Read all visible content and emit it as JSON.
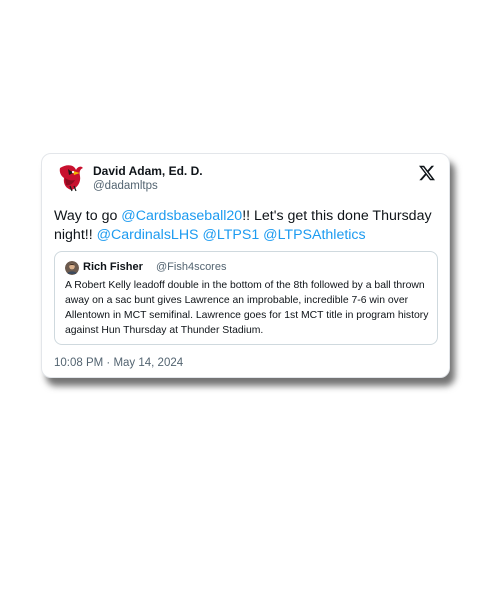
{
  "tweet": {
    "author_name": "David Adam, Ed. D.",
    "author_handle": "@dadamltps",
    "text_parts": [
      {
        "text": "Way to go ",
        "mention": false
      },
      {
        "text": "@Cardsbaseball20",
        "mention": true
      },
      {
        "text": "!! Let's get this done Thursday night!! ",
        "mention": false
      },
      {
        "text": "@CardinalsLHS",
        "mention": true
      },
      {
        "text": " ",
        "mention": false
      },
      {
        "text": "@LTPS1",
        "mention": true
      },
      {
        "text": " ",
        "mention": false
      },
      {
        "text": "@LTPSAthletics",
        "mention": true
      }
    ],
    "timestamp": "10:08 PM · May 14, 2024"
  },
  "quote": {
    "author_name": "Rich Fisher",
    "author_handle": "@Fish4scores",
    "text": "A Robert Kelly leadoff double in the bottom of the 8th followed by a ball thrown away on a sac bunt gives Lawrence an improbable, incredible 7-6 win over Allentown in MCT semifinal. Lawrence goes for 1st MCT title in program history against Hun Thursday at Thunder Stadium."
  },
  "icons": {
    "avatar": "cardinal-logo-avatar",
    "quote_avatar": "profile-photo-avatar",
    "brand": "x-logo-icon"
  },
  "colors": {
    "mention": "#1d9bf0",
    "text": "#0f1419",
    "secondary": "#536471",
    "border": "#cfd9de"
  }
}
